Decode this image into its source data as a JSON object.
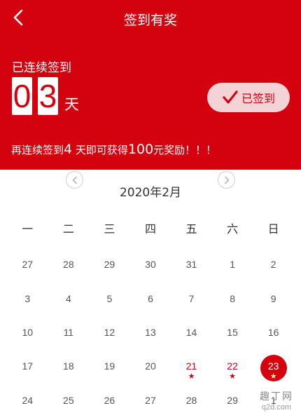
{
  "header": {
    "title": "签到有奖",
    "streak_label": "已连续签到",
    "streak_digits": [
      "0",
      "3"
    ],
    "streak_unit": "天",
    "signed_button_label": "已签到",
    "reward_prefix": "再连续签到",
    "reward_days": "4",
    "reward_mid": " 天即可获得",
    "reward_amount": "100",
    "reward_suffix": "元奖励！！！"
  },
  "calendar": {
    "month_label": "2020年2月",
    "weekdays": [
      "一",
      "二",
      "三",
      "四",
      "五",
      "六",
      "日"
    ],
    "weeks": [
      [
        {
          "d": "27"
        },
        {
          "d": "28"
        },
        {
          "d": "29"
        },
        {
          "d": "30"
        },
        {
          "d": "31"
        },
        {
          "d": "1"
        },
        {
          "d": "2"
        }
      ],
      [
        {
          "d": "3"
        },
        {
          "d": "4"
        },
        {
          "d": "5"
        },
        {
          "d": "6"
        },
        {
          "d": "7"
        },
        {
          "d": "8"
        },
        {
          "d": "9"
        }
      ],
      [
        {
          "d": "10"
        },
        {
          "d": "11"
        },
        {
          "d": "12"
        },
        {
          "d": "13"
        },
        {
          "d": "14"
        },
        {
          "d": "15"
        },
        {
          "d": "16"
        }
      ],
      [
        {
          "d": "17"
        },
        {
          "d": "18"
        },
        {
          "d": "19"
        },
        {
          "d": "20"
        },
        {
          "d": "21",
          "signed": true
        },
        {
          "d": "22",
          "signed": true
        },
        {
          "d": "23",
          "signed": true,
          "today": true
        }
      ],
      [
        {
          "d": "24"
        },
        {
          "d": "25"
        },
        {
          "d": "26"
        },
        {
          "d": "27"
        },
        {
          "d": "28"
        },
        {
          "d": "29"
        },
        {
          "d": "1"
        }
      ]
    ]
  },
  "watermark": {
    "top": "趣丁网",
    "bottom": "q2d.com"
  },
  "icons": {
    "back": "back-arrow-icon",
    "check": "checkmark-icon",
    "prev": "chevron-left-icon",
    "next": "chevron-right-icon",
    "star": "star-icon"
  },
  "colors": {
    "brand_red": "#d3020e",
    "signed_button_bg": "#f3d3d5"
  }
}
